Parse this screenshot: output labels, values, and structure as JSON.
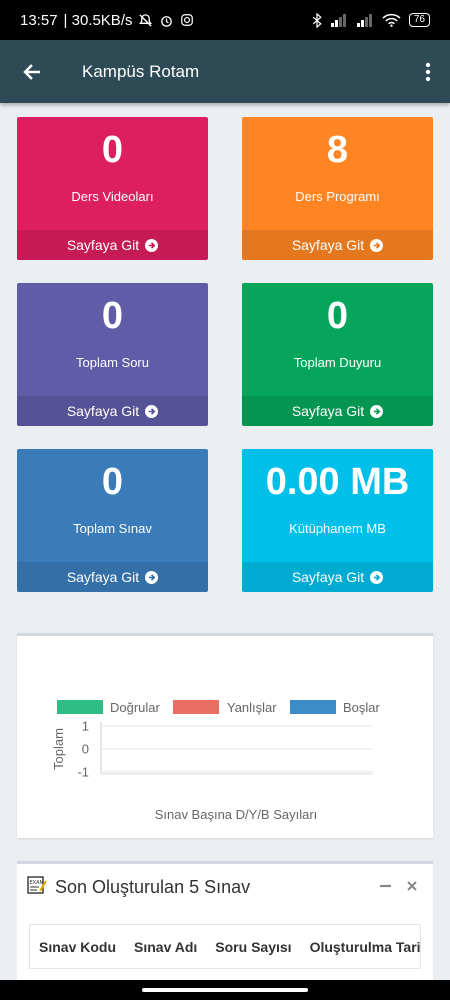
{
  "status_bar": {
    "time": "13:57",
    "speed": "| 30.5KB/s",
    "battery": "76"
  },
  "app_bar": {
    "title": "Kampüs Rotam"
  },
  "tiles": [
    {
      "value": "0",
      "label": "Ders Videoları",
      "link": "Sayfaya Git",
      "color": "#dd1e5f"
    },
    {
      "value": "8",
      "label": "Ders Programı",
      "link": "Sayfaya Git",
      "color": "#ff8522"
    },
    {
      "value": "0",
      "label": "Toplam Soru",
      "link": "Sayfaya Git",
      "color": "#605ca8"
    },
    {
      "value": "0",
      "label": "Toplam Duyuru",
      "link": "Sayfaya Git",
      "color": "#05a65b"
    },
    {
      "value": "0",
      "label": "Toplam Sınav",
      "link": "Sayfaya Git",
      "color": "#3a7cba"
    },
    {
      "value": "0.00 MB",
      "label": "Kütüphanem MB",
      "link": "Sayfaya Git",
      "color": "#00bfe9"
    }
  ],
  "chart_data": {
    "type": "bar",
    "categories": [],
    "series": [
      {
        "name": "Doğrular",
        "values": [],
        "color": "#2fbd85"
      },
      {
        "name": "Yanlışlar",
        "values": [],
        "color": "#e96f63"
      },
      {
        "name": "Boşlar",
        "values": [],
        "color": "#3b8bc8"
      }
    ],
    "ylabel": "Toplam",
    "xlabel": "Sınav Başına D/Y/B Sayıları",
    "yticks": [
      "1",
      "0",
      "-1"
    ],
    "ylim": [
      -1,
      1
    ],
    "legend": "top"
  },
  "exam_section": {
    "title": "Son Oluşturulan 5 Sınav",
    "columns": [
      "Sınav Kodu",
      "Sınav Adı",
      "Soru Sayısı",
      "Oluşturulma Tarihi"
    ]
  }
}
